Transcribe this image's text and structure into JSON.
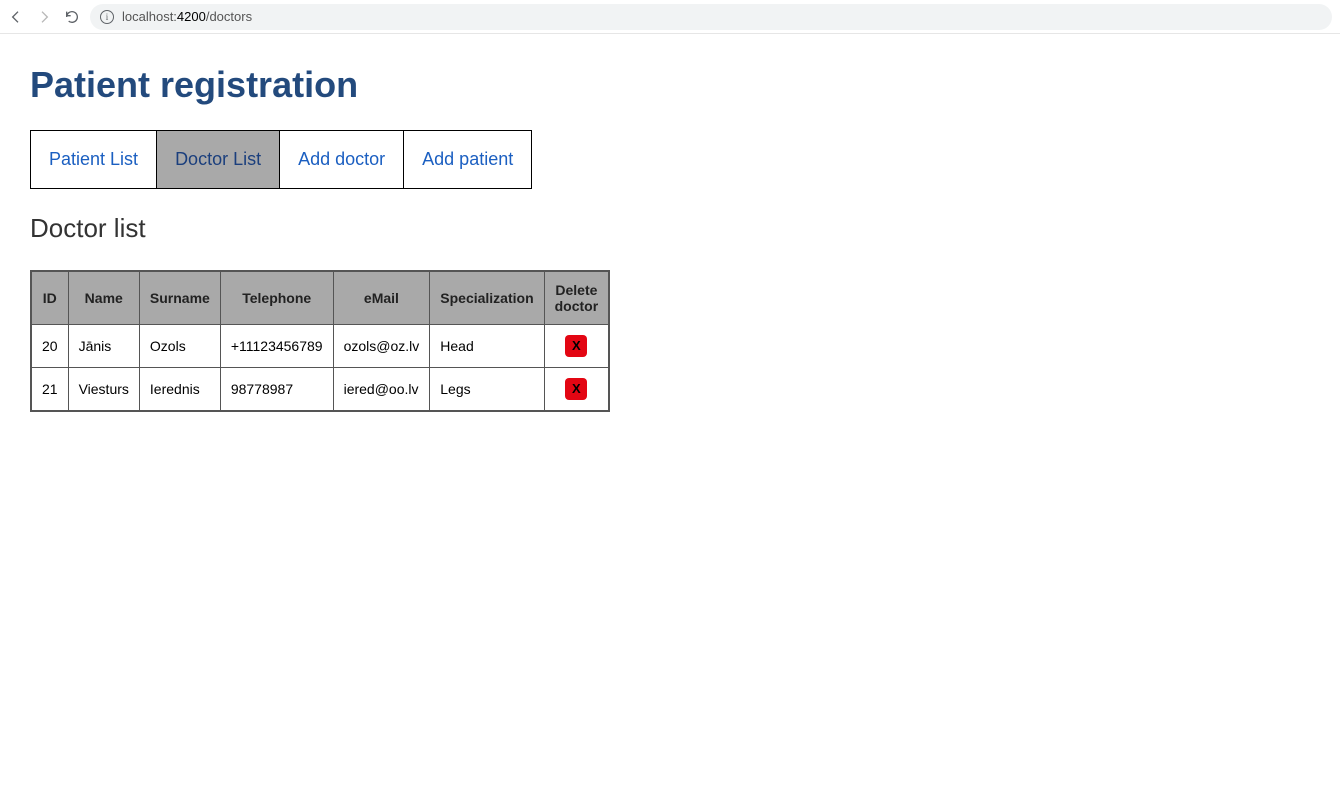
{
  "browser": {
    "url_prefix": "localhost:",
    "url_port": "4200",
    "url_path": "/doctors"
  },
  "header": {
    "title": "Patient registration"
  },
  "navTabs": [
    {
      "label": "Patient List",
      "active": false
    },
    {
      "label": "Doctor List",
      "active": true
    },
    {
      "label": "Add doctor",
      "active": false
    },
    {
      "label": "Add patient",
      "active": false
    }
  ],
  "section": {
    "title": "Doctor list"
  },
  "table": {
    "headers": [
      "ID",
      "Name",
      "Surname",
      "Telephone",
      "eMail",
      "Specialization",
      "Delete doctor"
    ],
    "rows": [
      {
        "id": "20",
        "name": "Jānis",
        "surname": "Ozols",
        "telephone": "+11123456789",
        "email": "ozols@oz.lv",
        "specialization": "Head",
        "deleteLabel": "X"
      },
      {
        "id": "21",
        "name": "Viesturs",
        "surname": "Ierednis",
        "telephone": "98778987",
        "email": "iered@oo.lv",
        "specialization": "Legs",
        "deleteLabel": "X"
      }
    ]
  }
}
